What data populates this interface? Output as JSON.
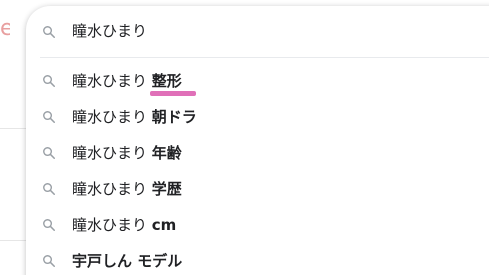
{
  "background": {
    "logo_fragment": "e"
  },
  "search": {
    "query": "瞳水ひまり",
    "icon": "search-icon"
  },
  "suggestions": [
    {
      "prefix": "瞳水ひまり ",
      "bold": "整形",
      "highlighted": true
    },
    {
      "prefix": "瞳水ひまり ",
      "bold": "朝ドラ",
      "highlighted": false
    },
    {
      "prefix": "瞳水ひまり ",
      "bold": "年齢",
      "highlighted": false
    },
    {
      "prefix": "瞳水ひまり ",
      "bold": "学歴",
      "highlighted": false
    },
    {
      "prefix": "瞳水ひまり ",
      "bold": "cm",
      "highlighted": false
    },
    {
      "prefix": "",
      "bold": "宇戸しん モデル",
      "highlighted": false
    }
  ],
  "colors": {
    "annotation": "#e070b8",
    "icon": "#9aa0a6",
    "text": "#202124"
  }
}
